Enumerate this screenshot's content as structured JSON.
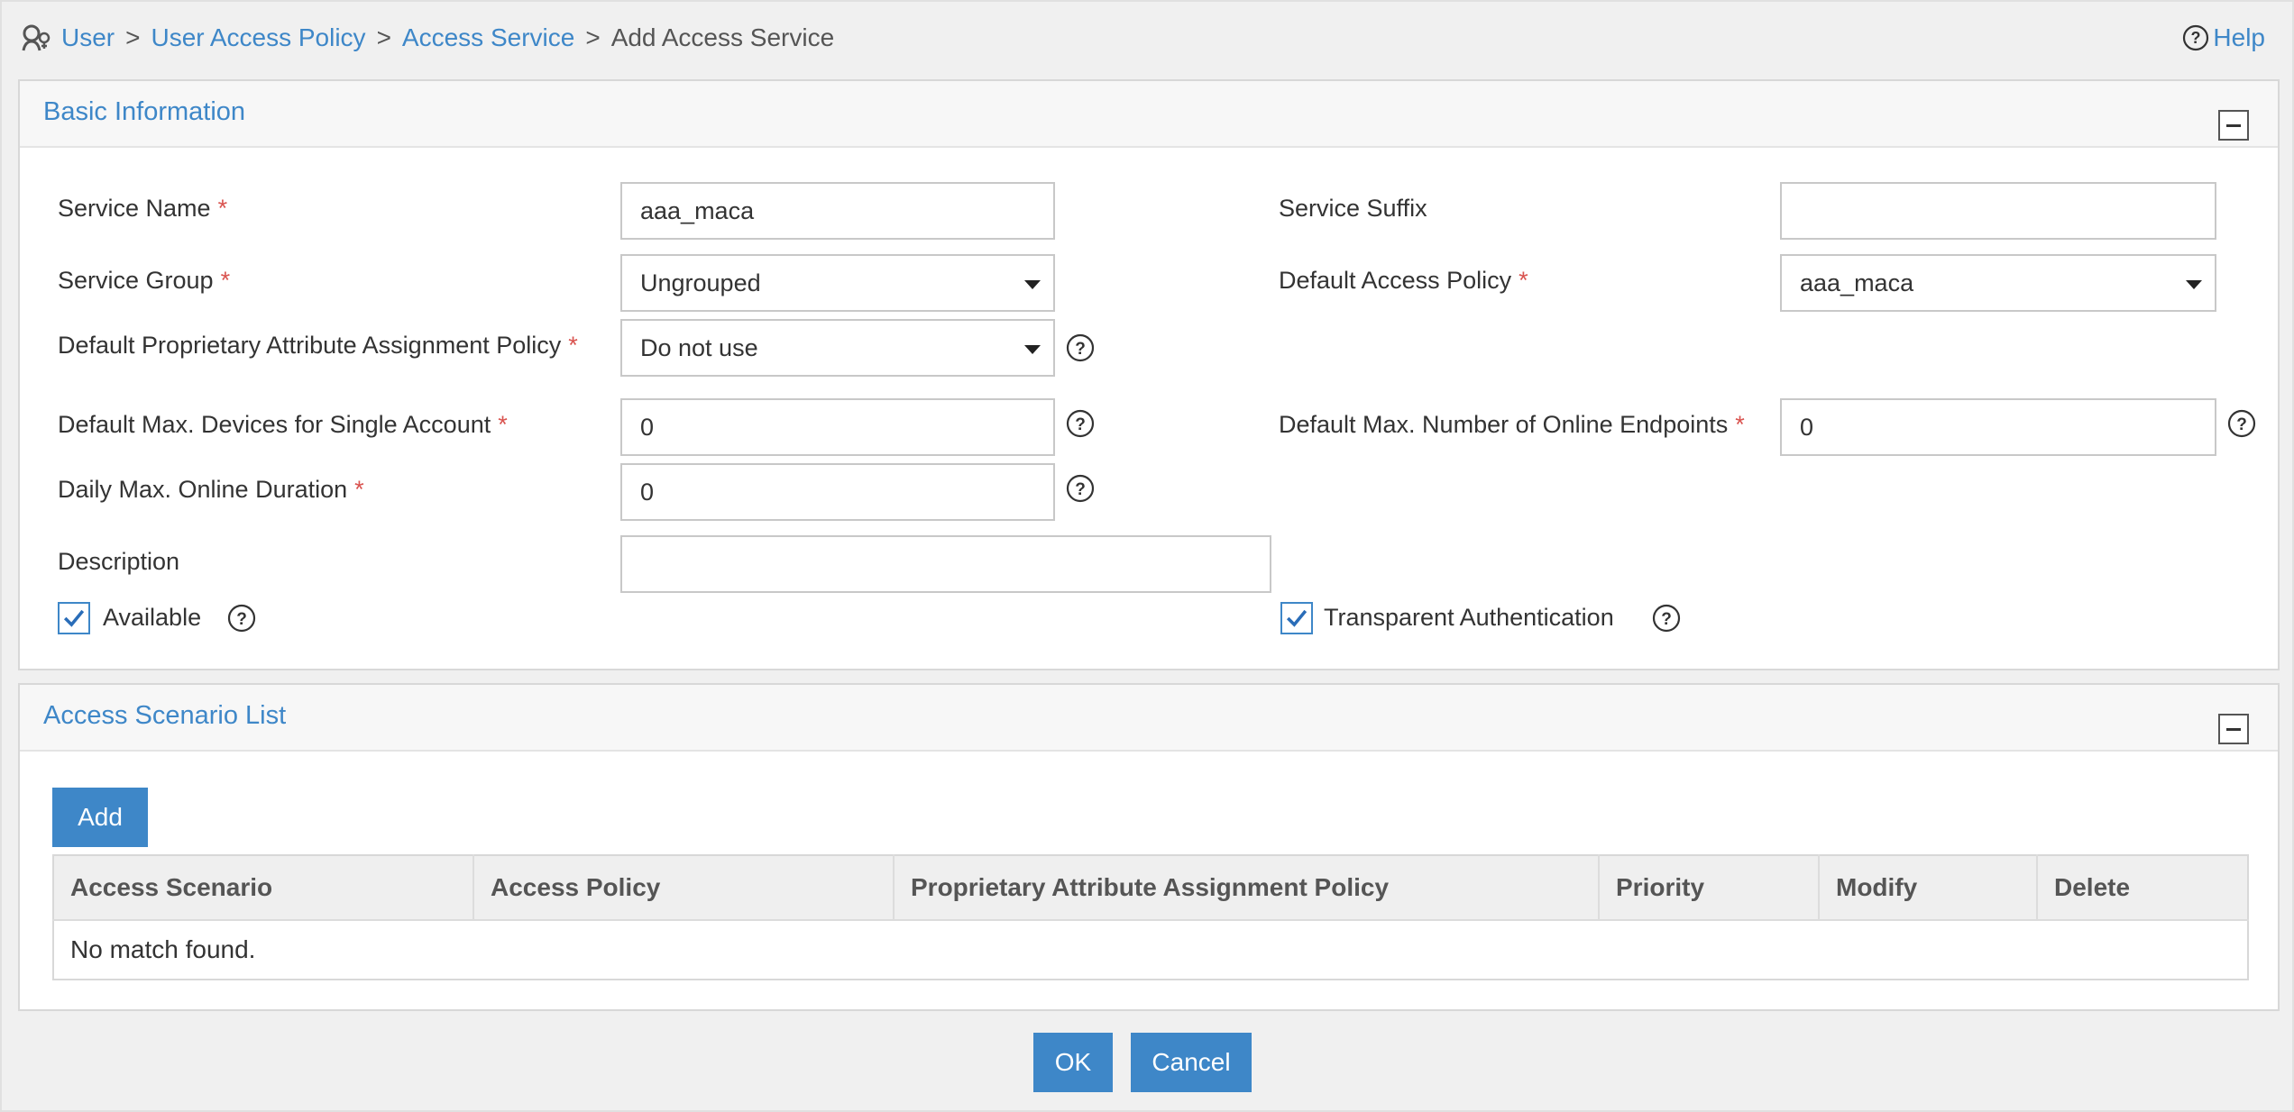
{
  "breadcrumb": {
    "items": [
      "User",
      "User Access Policy",
      "Access Service"
    ],
    "current": "Add Access Service",
    "separator": ">"
  },
  "help_label": "Help",
  "basic": {
    "title": "Basic Information",
    "service_name": {
      "label": "Service Name",
      "value": "aaa_maca"
    },
    "service_suffix": {
      "label": "Service Suffix",
      "value": ""
    },
    "service_group": {
      "label": "Service Group",
      "value": "Ungrouped"
    },
    "default_access_policy": {
      "label": "Default Access Policy",
      "value": "aaa_maca"
    },
    "default_prop_policy": {
      "label": "Default Proprietary Attribute Assignment Policy",
      "value": "Do not use"
    },
    "max_devices": {
      "label": "Default Max. Devices for Single Account",
      "value": "0"
    },
    "max_online_endpoints": {
      "label": "Default Max. Number of Online Endpoints",
      "value": "0"
    },
    "daily_max_duration": {
      "label": "Daily Max. Online Duration",
      "value": "0"
    },
    "description": {
      "label": "Description",
      "value": ""
    },
    "available": {
      "label": "Available",
      "checked": true
    },
    "transparent_auth": {
      "label": "Transparent Authentication",
      "checked": true
    },
    "required_mark": "*"
  },
  "scenario": {
    "title": "Access Scenario List",
    "add_label": "Add",
    "columns": [
      "Access Scenario",
      "Access Policy",
      "Proprietary Attribute Assignment Policy",
      "Priority",
      "Modify",
      "Delete"
    ],
    "empty_text": "No match found."
  },
  "footer": {
    "ok_label": "OK",
    "cancel_label": "Cancel"
  },
  "colors": {
    "accent": "#3e87c8",
    "required": "#d9534f"
  },
  "icons": {
    "home": "user-policy-icon",
    "help": "question-circle-icon",
    "collapse": "minus-box-icon",
    "check": "checkmark-icon"
  }
}
